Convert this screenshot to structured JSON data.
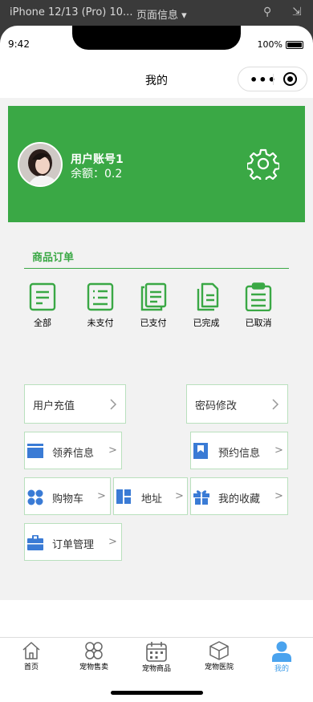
{
  "devtools": {
    "device": "iPhone 12/13 (Pro) 10...",
    "page_info": "页面信息 ▾"
  },
  "status": {
    "time": "9:42",
    "battery": "100%"
  },
  "nav": {
    "title": "我的"
  },
  "user": {
    "name": "用户账号1",
    "balance": "余额：0.2"
  },
  "orders": {
    "title": "商品订单",
    "items": [
      {
        "label": "全部",
        "icon": "document-icon"
      },
      {
        "label": "未支付",
        "icon": "list-icon"
      },
      {
        "label": "已支付",
        "icon": "clipboard-icon"
      },
      {
        "label": "已完成",
        "icon": "files-icon"
      },
      {
        "label": "已取消",
        "icon": "checklist-icon"
      }
    ]
  },
  "menu": {
    "recharge": "用户充值",
    "password": "密码修改",
    "adoption": "领养信息",
    "booking": "预约信息",
    "cart": "购物车",
    "address": "地址",
    "favorites": "我的收藏",
    "order_manage": "订单管理",
    "arrow": ">"
  },
  "tabbar": {
    "items": [
      {
        "label": "首页",
        "icon": "home-icon"
      },
      {
        "label": "宠物售卖",
        "icon": "clover-icon"
      },
      {
        "label": "宠物商品",
        "icon": "calendar-icon"
      },
      {
        "label": "宠物医院",
        "icon": "box-icon"
      },
      {
        "label": "我的",
        "icon": "user-icon"
      }
    ],
    "active_color": "#3b9be8"
  },
  "colors": {
    "brand_green": "#3aa845",
    "icon_blue": "#3a7bd5"
  }
}
